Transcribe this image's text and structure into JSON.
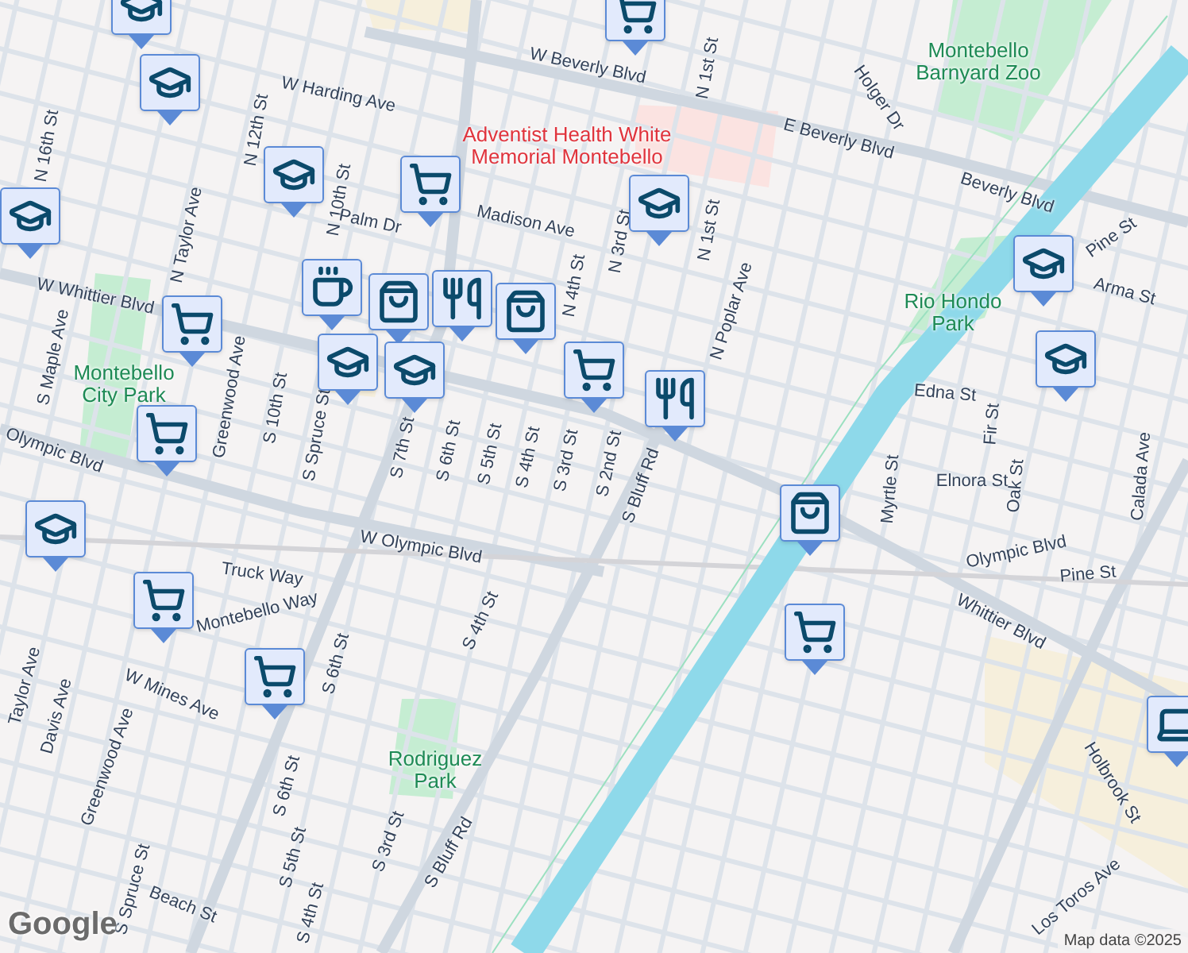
{
  "labels": [
    {
      "kind": "street",
      "text": "W Beverly Blvd"
    },
    {
      "kind": "street",
      "text": "W Harding Ave"
    },
    {
      "kind": "street",
      "text": "N 16th St"
    },
    {
      "kind": "street",
      "text": "N 12th St"
    },
    {
      "kind": "poi",
      "lines": [
        "Adventist Health White",
        "Memorial Montebello"
      ]
    },
    {
      "kind": "street",
      "text": "Holger Dr"
    },
    {
      "kind": "park",
      "lines": [
        "Montebello",
        "Barnyard Zoo"
      ]
    },
    {
      "kind": "street",
      "text": "E Beverly Blvd"
    },
    {
      "kind": "street",
      "text": "Beverly Blvd"
    },
    {
      "kind": "street",
      "text": "N 1st St"
    },
    {
      "kind": "street",
      "text": "N 1st St"
    },
    {
      "kind": "street",
      "text": "N 3rd St"
    },
    {
      "kind": "street",
      "text": "N Poplar Ave"
    },
    {
      "kind": "street",
      "text": "N Taylor Ave"
    },
    {
      "kind": "street",
      "text": "N 10th St"
    },
    {
      "kind": "street",
      "text": "Palm Dr"
    },
    {
      "kind": "street",
      "text": "Madison Ave"
    },
    {
      "kind": "street",
      "text": "N 4th St"
    },
    {
      "kind": "street",
      "text": "W Whittier Blvd"
    },
    {
      "kind": "street",
      "text": "S Maple Ave"
    },
    {
      "kind": "park",
      "lines": [
        "Montebello",
        "City Park"
      ]
    },
    {
      "kind": "street",
      "text": "Greenwood Ave"
    },
    {
      "kind": "street",
      "text": "S 10th St"
    },
    {
      "kind": "street",
      "text": "S Spruce St"
    },
    {
      "kind": "street",
      "text": "S 7th St"
    },
    {
      "kind": "street",
      "text": "S 6th St"
    },
    {
      "kind": "street",
      "text": "S 5th St"
    },
    {
      "kind": "street",
      "text": "S 4th St"
    },
    {
      "kind": "street",
      "text": "S 3rd St"
    },
    {
      "kind": "street",
      "text": "S 2nd St"
    },
    {
      "kind": "street",
      "text": "S Bluff Rd"
    },
    {
      "kind": "street",
      "text": "Olympic Blvd"
    },
    {
      "kind": "park",
      "lines": [
        "Rio Hondo",
        "Park"
      ]
    },
    {
      "kind": "street",
      "text": "Pine St"
    },
    {
      "kind": "street",
      "text": "Arma St"
    },
    {
      "kind": "street",
      "text": "Edna St"
    },
    {
      "kind": "street",
      "text": "Fir St"
    },
    {
      "kind": "street",
      "text": "Myrtle St"
    },
    {
      "kind": "street",
      "text": "Elnora St"
    },
    {
      "kind": "street",
      "text": "Oak St"
    },
    {
      "kind": "street",
      "text": "Calada Ave"
    },
    {
      "kind": "street",
      "text": "Olympic Blvd"
    },
    {
      "kind": "street",
      "text": "Pine St"
    },
    {
      "kind": "street",
      "text": "Whittier Blvd"
    },
    {
      "kind": "street",
      "text": "W Olympic Blvd"
    },
    {
      "kind": "street",
      "text": "Truck Way"
    },
    {
      "kind": "street",
      "text": "Montebello Way"
    },
    {
      "kind": "street",
      "text": "W Mines Ave"
    },
    {
      "kind": "street",
      "text": "S 6th St"
    },
    {
      "kind": "street",
      "text": "S 4th St"
    },
    {
      "kind": "street",
      "text": "Taylor Ave"
    },
    {
      "kind": "street",
      "text": "Davis Ave"
    },
    {
      "kind": "street",
      "text": "Greenwood Ave"
    },
    {
      "kind": "park",
      "lines": [
        "Rodriguez",
        "Park"
      ]
    },
    {
      "kind": "street",
      "text": "S 3rd St"
    },
    {
      "kind": "street",
      "text": "S 6th St"
    },
    {
      "kind": "street",
      "text": "S 5th St"
    },
    {
      "kind": "street",
      "text": "S Bluff Rd"
    },
    {
      "kind": "street",
      "text": "S Spruce St"
    },
    {
      "kind": "street",
      "text": "Beach St"
    },
    {
      "kind": "street",
      "text": "S 4th St"
    },
    {
      "kind": "street",
      "text": "Holbrook St"
    },
    {
      "kind": "street",
      "text": "Los Toros Ave"
    }
  ],
  "markers": [
    {
      "kind": "school"
    },
    {
      "kind": "school"
    },
    {
      "kind": "school"
    },
    {
      "kind": "school"
    },
    {
      "kind": "school"
    },
    {
      "kind": "school"
    },
    {
      "kind": "school"
    },
    {
      "kind": "school"
    },
    {
      "kind": "grocery"
    },
    {
      "kind": "grocery"
    },
    {
      "kind": "grocery"
    },
    {
      "kind": "grocery"
    },
    {
      "kind": "grocery"
    },
    {
      "kind": "grocery"
    },
    {
      "kind": "grocery"
    },
    {
      "kind": "cafe"
    },
    {
      "kind": "shop"
    },
    {
      "kind": "restaurant"
    },
    {
      "kind": "shop"
    },
    {
      "kind": "school"
    },
    {
      "kind": "school"
    },
    {
      "kind": "grocery"
    },
    {
      "kind": "restaurant"
    },
    {
      "kind": "shop"
    },
    {
      "kind": "computer"
    }
  ],
  "branding": {
    "logo": "Google",
    "attribution": "Map data ©2025"
  }
}
